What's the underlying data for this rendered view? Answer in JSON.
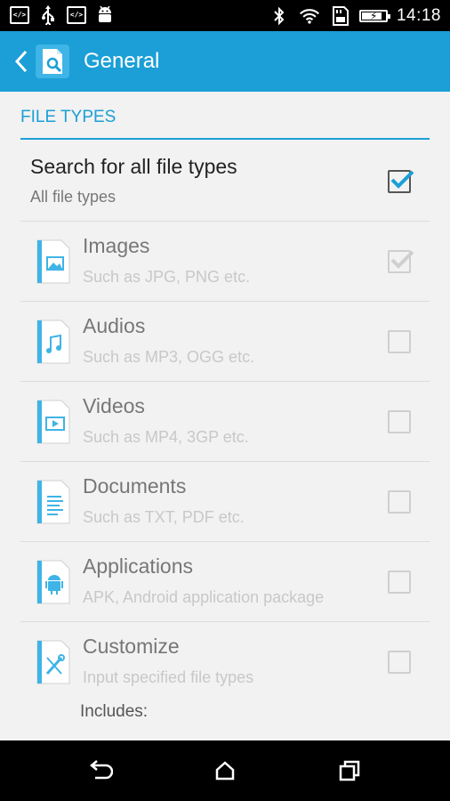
{
  "status_bar": {
    "left_icons": [
      "code-icon",
      "usb-icon",
      "code-icon",
      "android-icon"
    ],
    "right_icons": [
      "bluetooth-icon",
      "wifi-icon",
      "sd-card-icon",
      "battery-icon"
    ],
    "battery_level": 0.8,
    "time": "14:18"
  },
  "app_bar": {
    "title": "General",
    "accent": "#1b9fd6"
  },
  "section": {
    "title": "FILE TYPES"
  },
  "main_option": {
    "title": "Search for all file types",
    "subtitle": "All file types",
    "checked": true
  },
  "file_types": [
    {
      "title": "Images",
      "subtitle": "Such as JPG, PNG etc.",
      "icon": "image-file-icon",
      "checked": true,
      "enabled": false
    },
    {
      "title": "Audios",
      "subtitle": "Such as MP3, OGG etc.",
      "icon": "audio-file-icon",
      "checked": false,
      "enabled": false
    },
    {
      "title": "Videos",
      "subtitle": "Such as MP4, 3GP etc.",
      "icon": "video-file-icon",
      "checked": false,
      "enabled": false
    },
    {
      "title": "Documents",
      "subtitle": "Such as TXT, PDF etc.",
      "icon": "document-file-icon",
      "checked": false,
      "enabled": false
    },
    {
      "title": "Applications",
      "subtitle": "APK, Android application package",
      "icon": "android-file-icon",
      "checked": false,
      "enabled": false
    },
    {
      "title": "Customize",
      "subtitle": "Input specified file types",
      "icon": "tools-file-icon",
      "checked": false,
      "enabled": false
    }
  ],
  "includes_label": "Includes:",
  "nav_bar": {
    "buttons": [
      "back-icon",
      "home-icon",
      "recents-icon"
    ]
  }
}
